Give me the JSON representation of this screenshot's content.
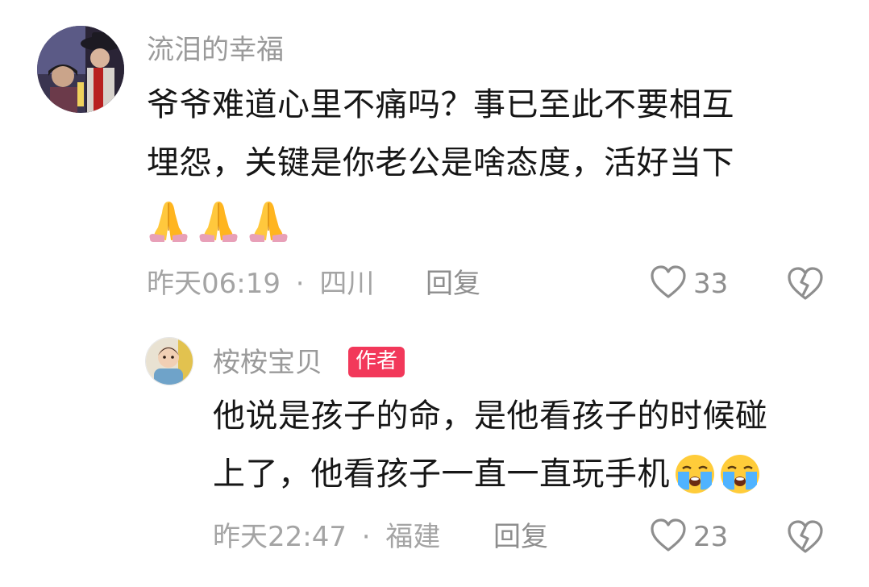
{
  "comments": [
    {
      "username": "流泪的幸福",
      "text_lines": [
        "爷爷难道心里不痛吗？事已至此不要相互",
        "埋怨，关键是你老公是啥态度，活好当下"
      ],
      "emojis_line": [
        "folded-hands-emoji",
        "folded-hands-emoji",
        "folded-hands-emoji"
      ],
      "time": "昨天06:19",
      "separator": "·",
      "location": "四川",
      "reply_label": "回复",
      "likes": "33"
    }
  ],
  "reply": {
    "username": "桉桉宝贝",
    "badge": "作者",
    "text_lines": [
      "他说是孩子的命，是他看孩子的时候碰",
      "上了，他看孩子一直一直玩手机"
    ],
    "trailing_emojis": [
      "loudly-crying-face-emoji",
      "loudly-crying-face-emoji"
    ],
    "time": "昨天22:47",
    "separator": "·",
    "location": "福建",
    "reply_label": "回复",
    "likes": "23"
  },
  "colors": {
    "badge_bg": "#f2385a",
    "meta_text": "#a4a4a4",
    "body_text": "#161616"
  },
  "icons": {
    "like": "heart-outline-icon",
    "dislike": "broken-heart-outline-icon"
  }
}
